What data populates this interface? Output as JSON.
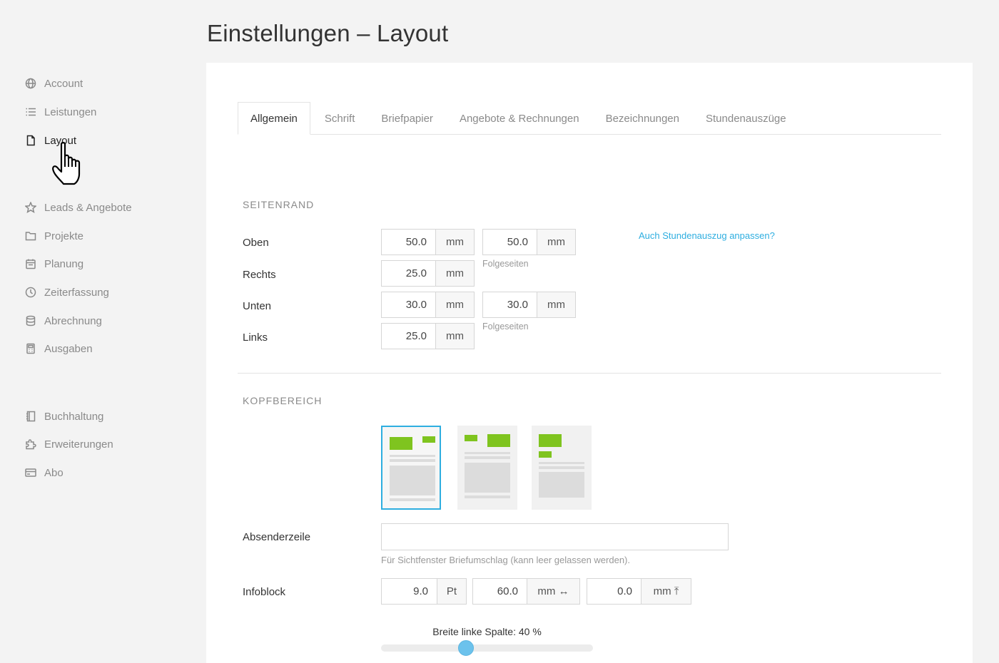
{
  "page_title": "Einstellungen – Layout",
  "sidebar": {
    "items": [
      {
        "label": "Account",
        "icon": "globe-icon"
      },
      {
        "label": "Leistungen",
        "icon": "list-icon"
      },
      {
        "label": "Layout",
        "icon": "document-icon",
        "active": true
      },
      {
        "label": "Leads & Angebote",
        "icon": "star-icon"
      },
      {
        "label": "Projekte",
        "icon": "folder-icon"
      },
      {
        "label": "Planung",
        "icon": "calendar-icon"
      },
      {
        "label": "Zeiterfassung",
        "icon": "clock-icon"
      },
      {
        "label": "Abrechnung",
        "icon": "database-icon"
      },
      {
        "label": "Ausgaben",
        "icon": "calculator-icon"
      },
      {
        "label": "Buchhaltung",
        "icon": "ledger-icon"
      },
      {
        "label": "Erweiterungen",
        "icon": "puzzle-icon"
      },
      {
        "label": "Abo",
        "icon": "credit-card-icon"
      }
    ]
  },
  "tabs": [
    "Allgemein",
    "Schrift",
    "Briefpapier",
    "Angebote & Rechnungen",
    "Bezeichnungen",
    "Stundenauszüge"
  ],
  "seitenrand": {
    "heading": "Seitenrand",
    "link": "Auch Stundenauszug anpassen?",
    "oben": {
      "label": "Oben",
      "value": "50.0",
      "unit": "mm",
      "follow_value": "50.0",
      "follow_unit": "mm",
      "follow_hint": "Folgeseiten"
    },
    "rechts": {
      "label": "Rechts",
      "value": "25.0",
      "unit": "mm"
    },
    "unten": {
      "label": "Unten",
      "value": "30.0",
      "unit": "mm",
      "follow_value": "30.0",
      "follow_unit": "mm",
      "follow_hint": "Folgeseiten"
    },
    "links": {
      "label": "Links",
      "value": "25.0",
      "unit": "mm"
    }
  },
  "kopfbereich": {
    "heading": "Kopfbereich",
    "absender_label": "Absenderzeile",
    "absender_value": "",
    "absender_hint": "Für Sichtfenster Briefumschlag (kann leer gelassen werden).",
    "infoblock_label": "Infoblock",
    "infoblock": [
      {
        "value": "9.0",
        "unit": "Pt"
      },
      {
        "value": "60.0",
        "unit": "mm ↔"
      },
      {
        "value": "0.0",
        "unit": "mm ⤒"
      }
    ],
    "slider_label": "Breite linke Spalte: 40 %",
    "slider_value": 40
  },
  "colors": {
    "accent": "#2eaee0",
    "brand_green": "#7fc41f",
    "slider": "#6cc2ec"
  }
}
